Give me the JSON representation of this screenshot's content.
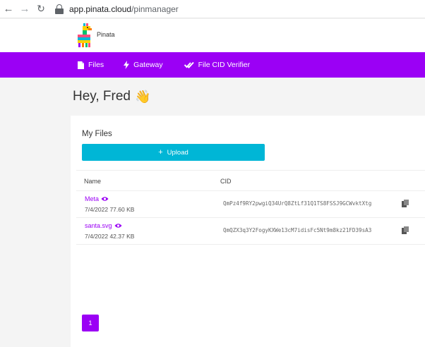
{
  "browser": {
    "url_host": "app.pinata.cloud",
    "url_path": "/pinmanager"
  },
  "header": {
    "brand": "Pinata"
  },
  "nav": {
    "items": [
      {
        "label": "Files",
        "icon": "file-icon"
      },
      {
        "label": "Gateway",
        "icon": "lightning-icon"
      },
      {
        "label": "File CID Verifier",
        "icon": "double-check-icon"
      }
    ]
  },
  "main": {
    "greeting": "Hey, Fred",
    "greeting_emoji": "👋",
    "files_title": "My Files",
    "upload_label": "Upload",
    "table": {
      "columns": [
        "Name",
        "CID"
      ],
      "rows": [
        {
          "name": "Meta",
          "meta": "7/4/2022 77.60 KB",
          "cid": "QmPz4f9RY2pwgiQ34UrQ8ZtLf31Q1TS8FSSJ9GCWvktXtg"
        },
        {
          "name": "santa.svg",
          "meta": "7/4/2022 42.37 KB",
          "cid": "QmQZX3q3Y2FogyKXWe13cM7idisFc5Nt9m8kz21FD39sA3"
        }
      ]
    },
    "pagination": {
      "current_page": "1"
    }
  },
  "colors": {
    "brand_purple": "#9b00f5",
    "upload_cyan": "#00b6d6"
  }
}
